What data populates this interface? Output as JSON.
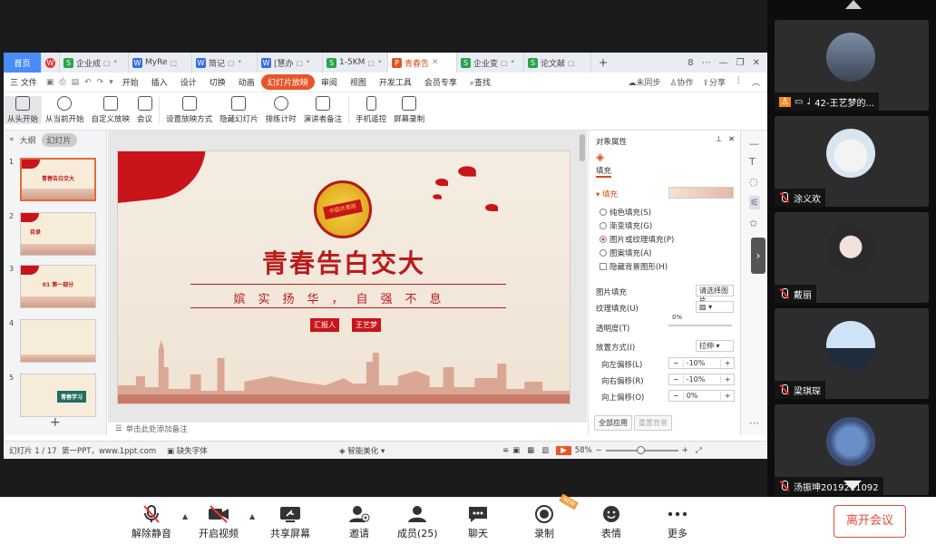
{
  "tabs": [
    {
      "label": "首页",
      "icon": "home"
    },
    {
      "label": "",
      "icon": "wps-logo-icon"
    },
    {
      "label": "企业成",
      "icon": "sheet-icon"
    },
    {
      "label": "MyRe",
      "icon": "word-icon"
    },
    {
      "label": "简记",
      "icon": "word-icon"
    },
    {
      "label": "[慧办",
      "icon": "doc-icon"
    },
    {
      "label": "1-5KM",
      "icon": "sheet-icon"
    },
    {
      "label": "青春告",
      "icon": "ppt-icon"
    },
    {
      "label": "企业变",
      "icon": "sheet-icon"
    },
    {
      "label": "论文献",
      "icon": "sheet-icon"
    }
  ],
  "tab_add": "+",
  "window_controls": [
    "8",
    "⋯",
    "—",
    "❐",
    "✕"
  ],
  "menu": {
    "file": "三 文件",
    "items": [
      "开始",
      "插入",
      "设计",
      "切换",
      "动画",
      "幻灯片放映",
      "审阅",
      "视图",
      "开发工具",
      "会员专享"
    ],
    "active": "幻灯片放映",
    "search": "查找",
    "right": [
      "未同步",
      "协作",
      "分享"
    ]
  },
  "ribbon": {
    "buttons": [
      "从头开始",
      "从当前开始",
      "自定义放映",
      "会议",
      "设置放映方式",
      "隐藏幻灯片",
      "排练计时",
      "演讲者备注",
      "手机遥控",
      "屏幕录制"
    ]
  },
  "outline": {
    "tab_outline": "大纲",
    "tab_slides": "幻灯片",
    "thumbs": [
      {
        "num": "1",
        "title": "青春告白交大"
      },
      {
        "num": "2",
        "title": "目录"
      },
      {
        "num": "3",
        "title": "01 第一部分"
      },
      {
        "num": "4",
        "title": ""
      },
      {
        "num": "5",
        "title": "青春学习"
      }
    ],
    "add": "+"
  },
  "slide": {
    "emblem_text": "中国共青团",
    "title": "青春告白交大",
    "subtitle": "嫔实扬华，自强不息",
    "reporter_label": "汇报人",
    "reporter_name": "王艺梦"
  },
  "notes": "单击此处添加备注",
  "panel": {
    "header": "对象属性",
    "tab": "填充",
    "section": "填充",
    "options": [
      "纯色填充(S)",
      "渐变填充(G)",
      "图片或纹理填充(P)",
      "图案填充(A)"
    ],
    "hide_bg": "隐藏背景图形(H)",
    "picture_fill_label": "图片填充",
    "picture_fill_value": "请选择图片",
    "texture_label": "纹理填充(U)",
    "transparency_label": "透明度(T)",
    "transparency_value": "0%",
    "placement_label": "放置方式(I)",
    "placement_value": "拉伸",
    "offset_left_label": "向左偏移(L)",
    "offset_left_value": "-10%",
    "offset_right_label": "向右偏移(R)",
    "offset_right_value": "-10%",
    "offset_up_label": "向上偏移(O)",
    "offset_up_value": "0%",
    "apply_all": "全部应用",
    "reset_bg": "重置背景"
  },
  "status": {
    "slide_count": "幻灯片 1 / 17",
    "theme": "第一PPT，www.1ppt.com",
    "missing_font": "缺失字体",
    "smart": "智能美化",
    "zoom": "58%"
  },
  "participants": [
    {
      "name": "42-王艺梦的...",
      "avatar": "person-photo"
    },
    {
      "name": "涂义欢",
      "avatar": "cartoon-rabbit"
    },
    {
      "name": "戴丽",
      "avatar": "anime-girl"
    },
    {
      "name": "梁琪琛",
      "avatar": "person-back"
    },
    {
      "name": "汤振坤2019211092",
      "avatar": "cartoon-cat"
    }
  ],
  "meeting_bar": {
    "buttons": [
      {
        "label": "解除静音",
        "icon": "mic-muted-icon"
      },
      {
        "label": "开启视频",
        "icon": "video-off-icon"
      },
      {
        "label": "共享屏幕",
        "icon": "share-screen-icon"
      },
      {
        "label": "邀请",
        "icon": "invite-icon"
      },
      {
        "label": "成员(25)",
        "icon": "members-icon"
      },
      {
        "label": "聊天",
        "icon": "chat-icon"
      },
      {
        "label": "录制",
        "icon": "record-icon"
      },
      {
        "label": "表情",
        "icon": "emoji-icon"
      },
      {
        "label": "更多",
        "icon": "more-icon"
      }
    ],
    "leave": "离开会议",
    "new_tag": "NEW"
  },
  "colors": {
    "accent": "#e9552a",
    "slide_red": "#b81c1c",
    "leave": "#e04a3a"
  }
}
